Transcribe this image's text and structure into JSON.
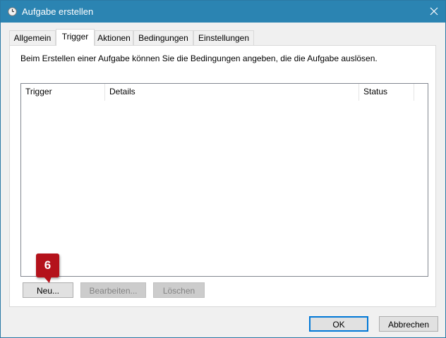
{
  "window": {
    "title": "Aufgabe erstellen",
    "icons": {
      "app": "clock-icon",
      "close": "close-icon"
    },
    "colors": {
      "titlebar": "#2b84b2",
      "badge": "#b4121b",
      "accent": "#0078d7"
    }
  },
  "tabs": [
    {
      "label": "Allgemein"
    },
    {
      "label": "Trigger",
      "active": true
    },
    {
      "label": "Aktionen"
    },
    {
      "label": "Bedingungen"
    },
    {
      "label": "Einstellungen"
    }
  ],
  "trigger_panel": {
    "description": "Beim Erstellen einer Aufgabe können Sie die Bedingungen angeben, die die Aufgabe auslösen.",
    "columns": [
      "Trigger",
      "Details",
      "Status"
    ],
    "rows": [],
    "buttons": {
      "new": "Neu...",
      "edit": "Bearbeiten...",
      "delete": "Löschen"
    }
  },
  "annotation": {
    "step": "6"
  },
  "dialog_buttons": {
    "ok": "OK",
    "cancel": "Abbrechen"
  }
}
